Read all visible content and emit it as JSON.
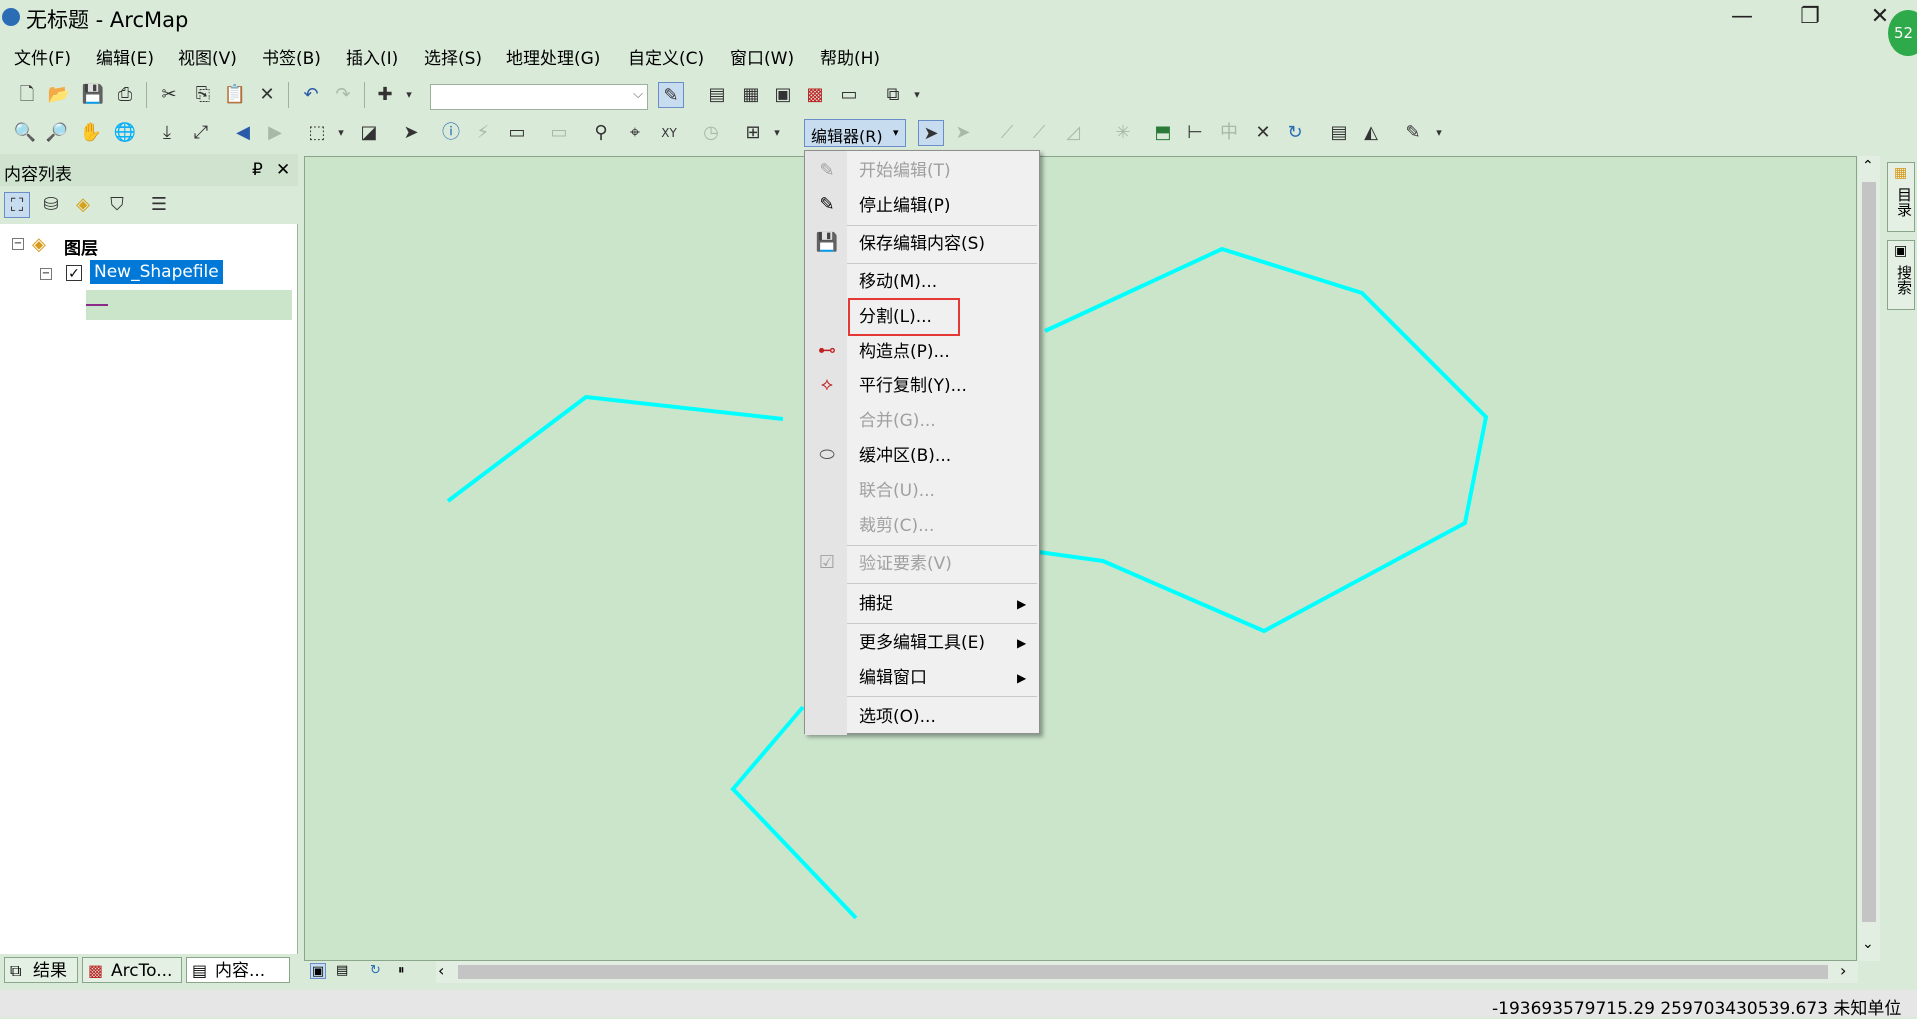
{
  "window": {
    "title": "无标题 - ArcMap",
    "minimize": "—",
    "restore": "❐",
    "close": "✕",
    "badge": "52"
  },
  "menubar": [
    "文件(F)",
    "编辑(E)",
    "视图(V)",
    "书签(B)",
    "插入(I)",
    "选择(S)",
    "地理处理(G)",
    "自定义(C)",
    "窗口(W)",
    "帮助(H)"
  ],
  "toolbar": {
    "editor_label": "编辑器(R)",
    "scale_value": ""
  },
  "toc": {
    "title": "内容列表",
    "pin": "₽",
    "close": "✕",
    "root_layer": "图层",
    "layer_name": "New_Shapefile",
    "layer_checked": true
  },
  "bottom_tabs": [
    "结果",
    "ArcTo...",
    "内容..."
  ],
  "right_dock": [
    "目录",
    "搜索"
  ],
  "status": {
    "coords": "-193693579715.29  259703430539.673 未知单位"
  },
  "editor_menu": [
    {
      "label": "开始编辑(T)",
      "disabled": true,
      "icon": "pencil-icon"
    },
    {
      "label": "停止编辑(P)",
      "disabled": false,
      "icon": "stop-edit-icon"
    },
    {
      "label": "保存编辑内容(S)",
      "disabled": false,
      "icon": "save-edits-icon"
    },
    {
      "label": "移动(M)...",
      "disabled": false
    },
    {
      "label": "分割(L)...",
      "disabled": false,
      "highlighted": true
    },
    {
      "label": "构造点(P)...",
      "disabled": false,
      "icon": "construct-points-icon"
    },
    {
      "label": "平行复制(Y)...",
      "disabled": false,
      "icon": "copy-parallel-icon"
    },
    {
      "label": "合并(G)...",
      "disabled": true
    },
    {
      "label": "缓冲区(B)...",
      "disabled": false,
      "icon": "buffer-icon"
    },
    {
      "label": "联合(U)...",
      "disabled": true
    },
    {
      "label": "裁剪(C)...",
      "disabled": true
    },
    {
      "label": "验证要素(V)",
      "disabled": true,
      "icon": "validate-icon"
    },
    {
      "label": "捕捉",
      "submenu": true
    },
    {
      "label": "更多编辑工具(E)",
      "submenu": true
    },
    {
      "label": "编辑窗口",
      "submenu": true
    },
    {
      "label": "选项(O)...",
      "disabled": false
    }
  ],
  "colors": {
    "feature_line": "#00ffff",
    "highlight_box": "#e53935",
    "selection": "#0078d7"
  }
}
